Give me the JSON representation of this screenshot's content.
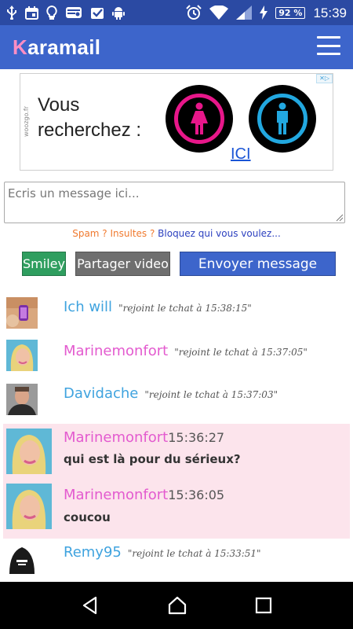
{
  "status_bar": {
    "icons": [
      "usb-icon",
      "calendar-icon",
      "bulb-icon",
      "card-icon",
      "task-icon",
      "android-icon",
      "alarm-icon",
      "wifi-icon",
      "signal-icon",
      "charging-icon"
    ],
    "battery": "92 %",
    "time": "15:39"
  },
  "header": {
    "logo_first": "K",
    "logo_rest": "aramail",
    "menu_icon": "hamburger-menu-icon"
  },
  "ad": {
    "side_text": "woozgo.fr",
    "headline_line1": "Vous",
    "headline_line2": "recherchez :",
    "cta": "ICI",
    "icons": [
      "woman-icon",
      "man-icon"
    ]
  },
  "composer": {
    "placeholder": "Ecris un message ici...",
    "spam_prefix": "Spam ? Insultes ? ",
    "spam_link": "Bloquez qui vous voulez..."
  },
  "buttons": {
    "smiley": "Smiley",
    "share_video": "Partager video",
    "send": "Envoyer message"
  },
  "feed": [
    {
      "type": "join",
      "nick": "Ich will",
      "color": "#3fa3df",
      "text": "\"rejoint le tchat à 15:38:15\""
    },
    {
      "type": "join",
      "nick": "Marinemonfort",
      "color": "#e35bcf",
      "text": "\"rejoint le tchat à 15:37:05\""
    },
    {
      "type": "join",
      "nick": "Davidache",
      "color": "#3fa3df",
      "text": "\"rejoint le tchat à 15:37:03\""
    },
    {
      "type": "message",
      "nick": "Marinemonfort",
      "color": "#e35bcf",
      "time": "15:36:27",
      "text": "qui est là pour du sérieux?"
    },
    {
      "type": "message",
      "nick": "Marinemonfort",
      "color": "#e35bcf",
      "time": "15:36:05",
      "text": "coucou"
    },
    {
      "type": "join",
      "nick": "Remy95",
      "color": "#3fa3df",
      "text": "\"rejoint le tchat à 15:33:51\""
    }
  ],
  "colors": {
    "status_bar": "#2b4aa3",
    "app_bar": "#3d65cb",
    "logo_accent": "#ff8ec4",
    "message_bg": "#fce4ec",
    "smiley_button": "#2f9e5f",
    "video_button": "#6f6f6f",
    "send_button": "#3d65cb"
  },
  "nav_bar": {
    "icons": [
      "back-icon",
      "home-icon",
      "recents-icon"
    ]
  }
}
